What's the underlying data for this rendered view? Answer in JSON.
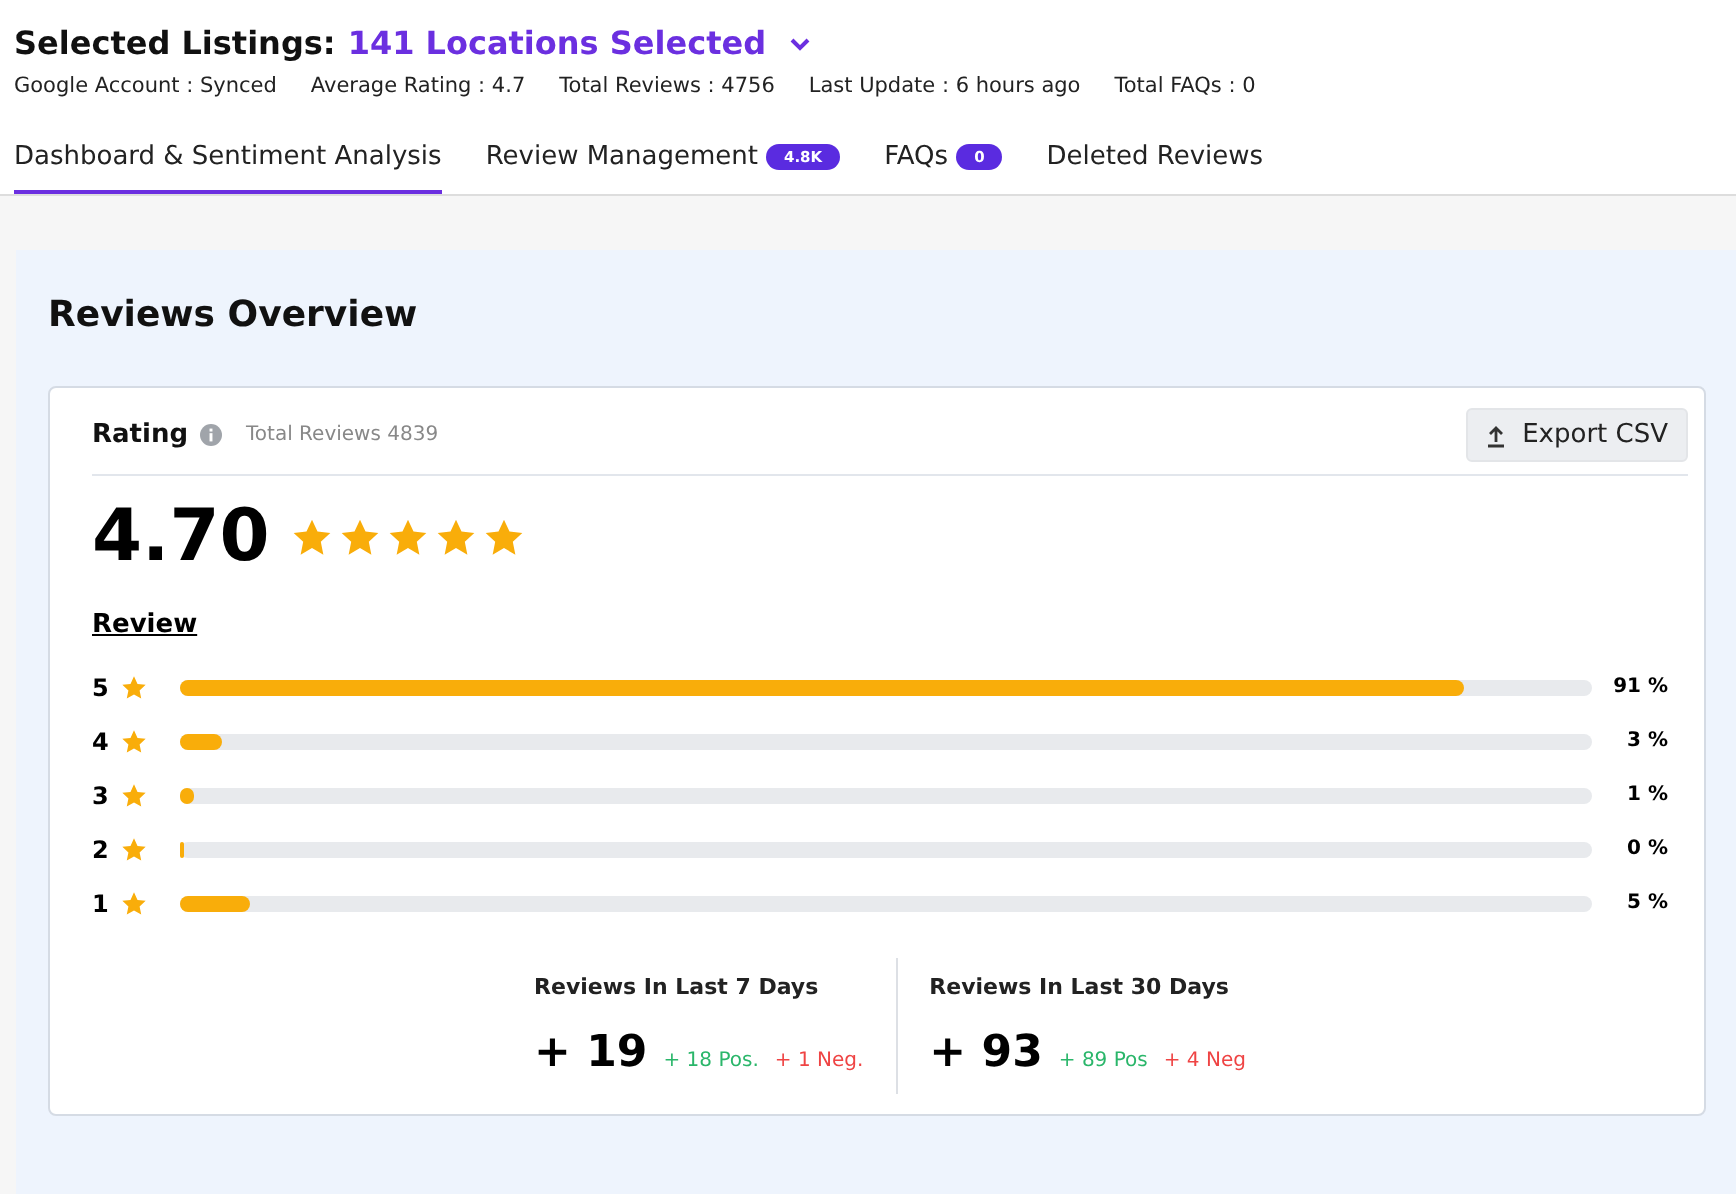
{
  "header": {
    "title_label": "Selected Listings:",
    "title_value": "141 Locations Selected",
    "stats": [
      "Google Account : Synced",
      "Average Rating : 4.7",
      "Total Reviews : 4756",
      "Last Update : 6 hours ago",
      "Total FAQs : 0"
    ]
  },
  "tabs": [
    {
      "label": "Dashboard & Sentiment Analysis",
      "selected": true
    },
    {
      "label": "Review Management",
      "badge": "4.8K",
      "selected": false
    },
    {
      "label": "FAQs",
      "badge": "0",
      "selected": false
    },
    {
      "label": "Deleted Reviews",
      "selected": false
    }
  ],
  "overview": {
    "title": "Reviews Overview",
    "card": {
      "label": "Rating",
      "total": "Total Reviews 4839",
      "export": "Export CSV",
      "rating": "4.70",
      "stars": 5,
      "review_label": "Review",
      "distribution": [
        {
          "star": "5",
          "level": 0.91,
          "percent": "91 %"
        },
        {
          "star": "4",
          "level": 0.03,
          "percent": "3 %"
        },
        {
          "star": "3",
          "level": 0.01,
          "percent": "1 %"
        },
        {
          "star": "2",
          "level": 0.0,
          "percent": "0 %"
        },
        {
          "star": "1",
          "level": 0.05,
          "percent": "5 %"
        }
      ],
      "periods": [
        {
          "title": "Reviews In Last 7 Days",
          "count": "+ 19",
          "pos": "+ 18 Pos.",
          "neg": "+ 1 Neg."
        },
        {
          "title": "Reviews In Last 30 Days",
          "count": "+ 93",
          "pos": "+ 89 Pos",
          "neg": "+ 4 Neg"
        }
      ]
    }
  }
}
